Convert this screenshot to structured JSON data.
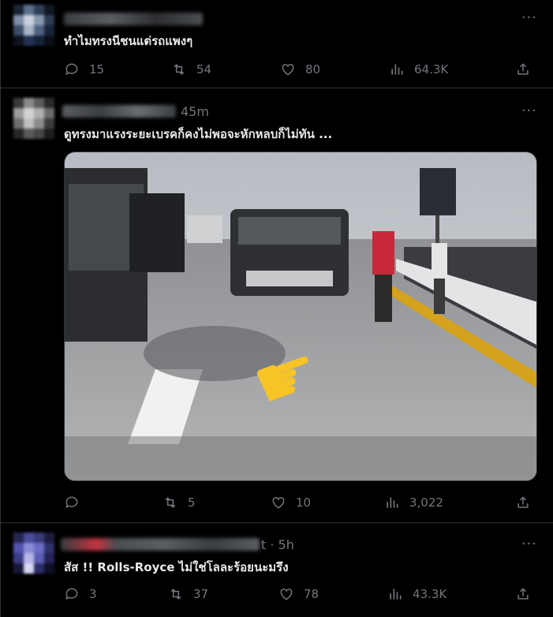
{
  "tweets": [
    {
      "text": "ทำไมทรงนีชนแต่รถแพงๆ",
      "stats": {
        "replies": "15",
        "retweets": "54",
        "likes": "80",
        "views": "64.3K"
      }
    },
    {
      "time": "45m",
      "text": "ดูทรงมาแรงระยะเบรคก็คงไม่พอจะหักหลบก็ไม่ทัน ...",
      "media_icon": "pointing-hand-emoji",
      "stats": {
        "replies": "",
        "retweets": "5",
        "likes": "10",
        "views": "3,022"
      }
    },
    {
      "time_suffix": "t · 5h",
      "text": "สัส !!  Rolls-Royce  ไม่ใช่โลละร้อยนะมรึง",
      "stats": {
        "replies": "3",
        "retweets": "37",
        "likes": "78",
        "views": "43.3K"
      }
    }
  ],
  "more_label": "···",
  "colors": {
    "background": "#000000",
    "text": "#e7e9ea",
    "muted": "#71767b",
    "divider": "#2f3336"
  },
  "icons": [
    "reply-icon",
    "retweet-icon",
    "like-icon",
    "views-icon",
    "share-icon",
    "more-icon"
  ]
}
